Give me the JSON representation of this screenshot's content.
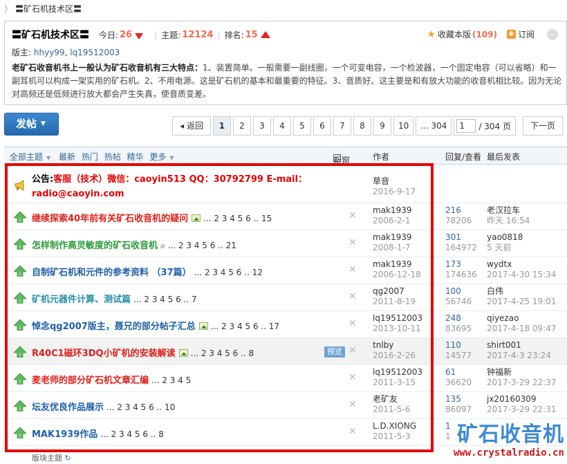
{
  "breadcrumb": {
    "separator": "〉",
    "title": "〓矿石机技术区〓"
  },
  "forum": {
    "title": "〓矿石机技术区〓",
    "today_label": "今日:",
    "today_value": "26",
    "topics_label": "主题:",
    "topics_value": "12124",
    "rank_label": "排名:",
    "rank_value": "15",
    "favorite_label": "收藏本版",
    "favorite_count": "(109)",
    "subscribe_label": "订阅",
    "moderators_label": "版主:",
    "moderators": [
      "hhyy99",
      "lq19512003"
    ],
    "desc_bold": "老矿石收音机书上一般认为矿石收音机有三大特点：",
    "desc_rest": "1、装置简单。一般需要一副线圈，一个可变电容，一个检波器，一个固定电容（可以省略）和一副耳机可以构成一架实用的矿石机。2、不用电源。这是矿石机的基本和最重要的特征。3、音质好。这主要是和有放大功能的收音机相比较。因为无论对高频还是低频进行放大都会产生失真，使音质变差。"
  },
  "toolbar": {
    "post_label": "发帖",
    "back_label": "返回",
    "pages": [
      "1",
      "2",
      "3",
      "4",
      "5",
      "6",
      "7",
      "8",
      "9",
      "10"
    ],
    "ellipsis_last": "... 304",
    "page_input": "1",
    "page_total": "/ 304 页",
    "next_label": "下一页"
  },
  "table_header": {
    "filters": [
      "全部主题",
      "最新",
      "热门",
      "热帖",
      "精华",
      "更多"
    ],
    "new_window": "新窗",
    "author": "作者",
    "replies_views": "回复/查看",
    "last_post": "最后发表"
  },
  "announcement": {
    "label": "公告:",
    "text": "客服（技术）微信：caoyin513   QQ：30792799   E-mail：radio@caoyin.com",
    "author": "草音",
    "date": "2016-9-17"
  },
  "threads": [
    {
      "title": "继续探索40年前有关矿石收音机的疑问",
      "color": "red",
      "image": true,
      "clip": false,
      "preview": false,
      "pages": "... 2 3 4 5 6 .. 15",
      "author": "mak1939",
      "date": "2006-2-1",
      "replies": "216",
      "views": "78206",
      "last_user": "老汉拉车",
      "last_time": "昨天 16:54",
      "highlight": false
    },
    {
      "title": "怎样制作高灵敏度的矿石收音机",
      "color": "green",
      "image": false,
      "clip": true,
      "preview": false,
      "pages": "... 2 3 4 5 6 .. 21",
      "author": "mak1939",
      "date": "2008-1-7",
      "replies": "301",
      "views": "164972",
      "last_user": "yao0818",
      "last_time": "5 天前",
      "highlight": false
    },
    {
      "title": "自制矿石机和元件的参考资料 （37篇）",
      "color": "blue",
      "image": false,
      "clip": false,
      "preview": false,
      "pages": "... 2 3 4 5 6 .. 12",
      "author": "mak1939",
      "date": "2006-12-18",
      "replies": "173",
      "views": "174636",
      "last_user": "wydtx",
      "last_time": "2017-4-30 15:34",
      "highlight": false
    },
    {
      "title": "矿机元器件计算、测试篇",
      "color": "teal",
      "image": false,
      "clip": false,
      "preview": false,
      "pages": "... 2 3 4 5 6 .. 7",
      "author": "qg2007",
      "date": "2011-8-19",
      "replies": "100",
      "views": "56746",
      "last_user": "白伟",
      "last_time": "2017-4-25 19:01",
      "highlight": false
    },
    {
      "title": "悼念qg2007版主，聂兄的部分帖子汇总",
      "color": "blue",
      "image": true,
      "clip": false,
      "preview": false,
      "pages": "... 2 3 4 5 6 .. 17",
      "author": "lq19512003",
      "date": "2013-10-11",
      "replies": "248",
      "views": "83695",
      "last_user": "qiyezao",
      "last_time": "2017-4-18 09:47",
      "highlight": false
    },
    {
      "title": "R40C1磁环3DQ小矿机的安装解读",
      "color": "red",
      "image": true,
      "clip": false,
      "preview": true,
      "pages": "... 2 3 4 5 6 .. 8",
      "author": "tnlby",
      "date": "2016-2-26",
      "replies": "110",
      "views": "14577",
      "last_user": "shirt001",
      "last_time": "2017-4-3 23:24",
      "highlight": true
    },
    {
      "title": "麦老师的部分矿石机文章汇编",
      "color": "red",
      "image": false,
      "clip": false,
      "preview": false,
      "pages": "... 2 3 4 5",
      "author": "lq19512003",
      "date": "2011-3-15",
      "replies": "61",
      "views": "36620",
      "last_user": "钟福新",
      "last_time": "2017-3-29 22:37",
      "highlight": false
    },
    {
      "title": "坛友优良作品展示",
      "color": "blue",
      "image": false,
      "clip": false,
      "preview": false,
      "pages": "... 2 3 4 5 6 .. 10",
      "author": "老矿友",
      "date": "2011-5-6",
      "replies": "135",
      "views": "86097",
      "last_user": "jx20160309",
      "last_time": "2017-3-29 22:31",
      "highlight": false
    },
    {
      "title": "MAK1939作品",
      "color": "blue",
      "image": false,
      "clip": false,
      "preview": false,
      "pages": "... 2 3 4 5 6 .. 8",
      "author": "L.D.XIONG",
      "date": "2011-5-3",
      "replies": "1",
      "views": "1",
      "last_user": "",
      "last_time": "",
      "highlight": false
    }
  ],
  "preview_label": "预览",
  "footer_hint": "版块主题",
  "watermark": {
    "logo_text": "矿石收音机",
    "url": "www.crystalradio.cn"
  },
  "colors": {
    "red": "#e0201b",
    "green": "#2b9b3a",
    "blue": "#1f5fa8",
    "teal": "#2c8fa6",
    "link": "#336699",
    "highlight_box": "#e60000"
  }
}
